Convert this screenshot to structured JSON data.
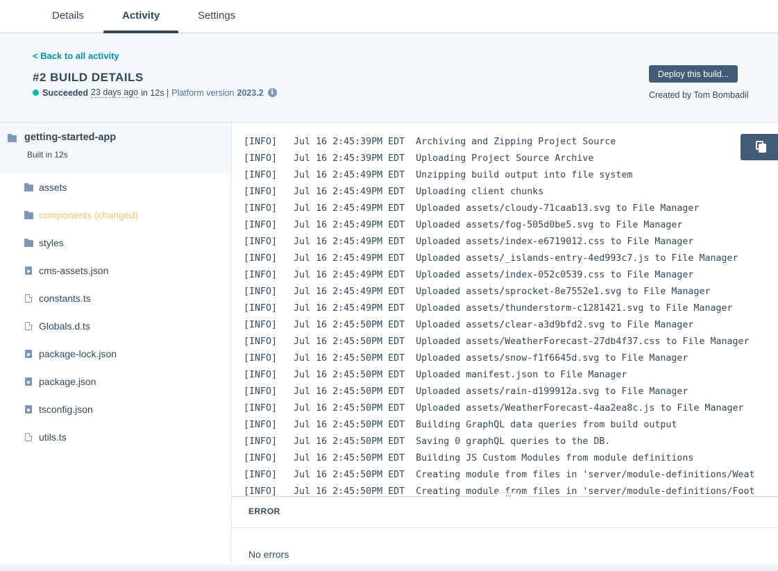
{
  "tabs": [
    {
      "label": "Details"
    },
    {
      "label": "Activity"
    },
    {
      "label": "Settings"
    }
  ],
  "header": {
    "back_link": "< Back to all activity",
    "title": "#2 BUILD DETAILS",
    "status": "Succeeded",
    "time_ago": "23 days ago",
    "duration": "in 12s |",
    "platform_label": "Platform version",
    "platform_version": "2023.2",
    "info_icon": "i",
    "deploy_button": "Deploy this build...",
    "created_by": "Created by Tom Bombadil",
    "status_color": "#00bda5"
  },
  "sidebar": {
    "root": {
      "name": "getting-started-app",
      "sub": "Built in 12s"
    },
    "items": [
      {
        "label": "assets",
        "icon": "folder-icon"
      },
      {
        "label": "components (changed)",
        "icon": "folder-icon"
      },
      {
        "label": "styles",
        "icon": "folder-icon"
      },
      {
        "label": "cms-assets.json",
        "icon": "locked-file-icon"
      },
      {
        "label": "constants.ts",
        "icon": "file-icon"
      },
      {
        "label": "Globals.d.ts",
        "icon": "file-icon"
      },
      {
        "label": "package-lock.json",
        "icon": "locked-file-icon"
      },
      {
        "label": "package.json",
        "icon": "locked-file-icon"
      },
      {
        "label": "tsconfig.json",
        "icon": "locked-file-icon"
      },
      {
        "label": "utils.ts",
        "icon": "file-icon"
      }
    ]
  },
  "log": {
    "lines": [
      "[INFO]   Jul 16 2:45:39PM EDT  Archiving and Zipping Project Source",
      "[INFO]   Jul 16 2:45:39PM EDT  Uploading Project Source Archive",
      "[INFO]   Jul 16 2:45:49PM EDT  Unzipping build output into file system",
      "[INFO]   Jul 16 2:45:49PM EDT  Uploading client chunks",
      "[INFO]   Jul 16 2:45:49PM EDT  Uploaded assets/cloudy-71caab13.svg to File Manager",
      "[INFO]   Jul 16 2:45:49PM EDT  Uploaded assets/fog-505d0be5.svg to File Manager",
      "[INFO]   Jul 16 2:45:49PM EDT  Uploaded assets/index-e6719012.css to File Manager",
      "[INFO]   Jul 16 2:45:49PM EDT  Uploaded assets/_islands-entry-4ed993c7.js to File Manager",
      "[INFO]   Jul 16 2:45:49PM EDT  Uploaded assets/index-052c0539.css to File Manager",
      "[INFO]   Jul 16 2:45:49PM EDT  Uploaded assets/sprocket-8e7552e1.svg to File Manager",
      "[INFO]   Jul 16 2:45:49PM EDT  Uploaded assets/thunderstorm-c1281421.svg to File Manager",
      "[INFO]   Jul 16 2:45:50PM EDT  Uploaded assets/clear-a3d9bfd2.svg to File Manager",
      "[INFO]   Jul 16 2:45:50PM EDT  Uploaded assets/WeatherForecast-27db4f37.css to File Manager",
      "[INFO]   Jul 16 2:45:50PM EDT  Uploaded assets/snow-f1f6645d.svg to File Manager",
      "[INFO]   Jul 16 2:45:50PM EDT  Uploaded manifest.json to File Manager",
      "[INFO]   Jul 16 2:45:50PM EDT  Uploaded assets/rain-d199912a.svg to File Manager",
      "[INFO]   Jul 16 2:45:50PM EDT  Uploaded assets/WeatherForecast-4aa2ea8c.js to File Manager",
      "[INFO]   Jul 16 2:45:50PM EDT  Building GraphQL data queries from build output",
      "[INFO]   Jul 16 2:45:50PM EDT  Saving 0 graphQL queries to the DB.",
      "[INFO]   Jul 16 2:45:50PM EDT  Building JS Custom Modules from module definitions",
      "[INFO]   Jul 16 2:45:50PM EDT  Creating module from files in 'server/module-definitions/Weat",
      "[INFO]   Jul 16 2:45:50PM EDT  Creating module from files in 'server/module-definitions/Foot"
    ]
  },
  "errors": {
    "title": "ERROR",
    "message": "No errors"
  },
  "colors": {
    "accent_link": "#0091ae",
    "changed": "#f5c26b",
    "button": "#425b76"
  }
}
